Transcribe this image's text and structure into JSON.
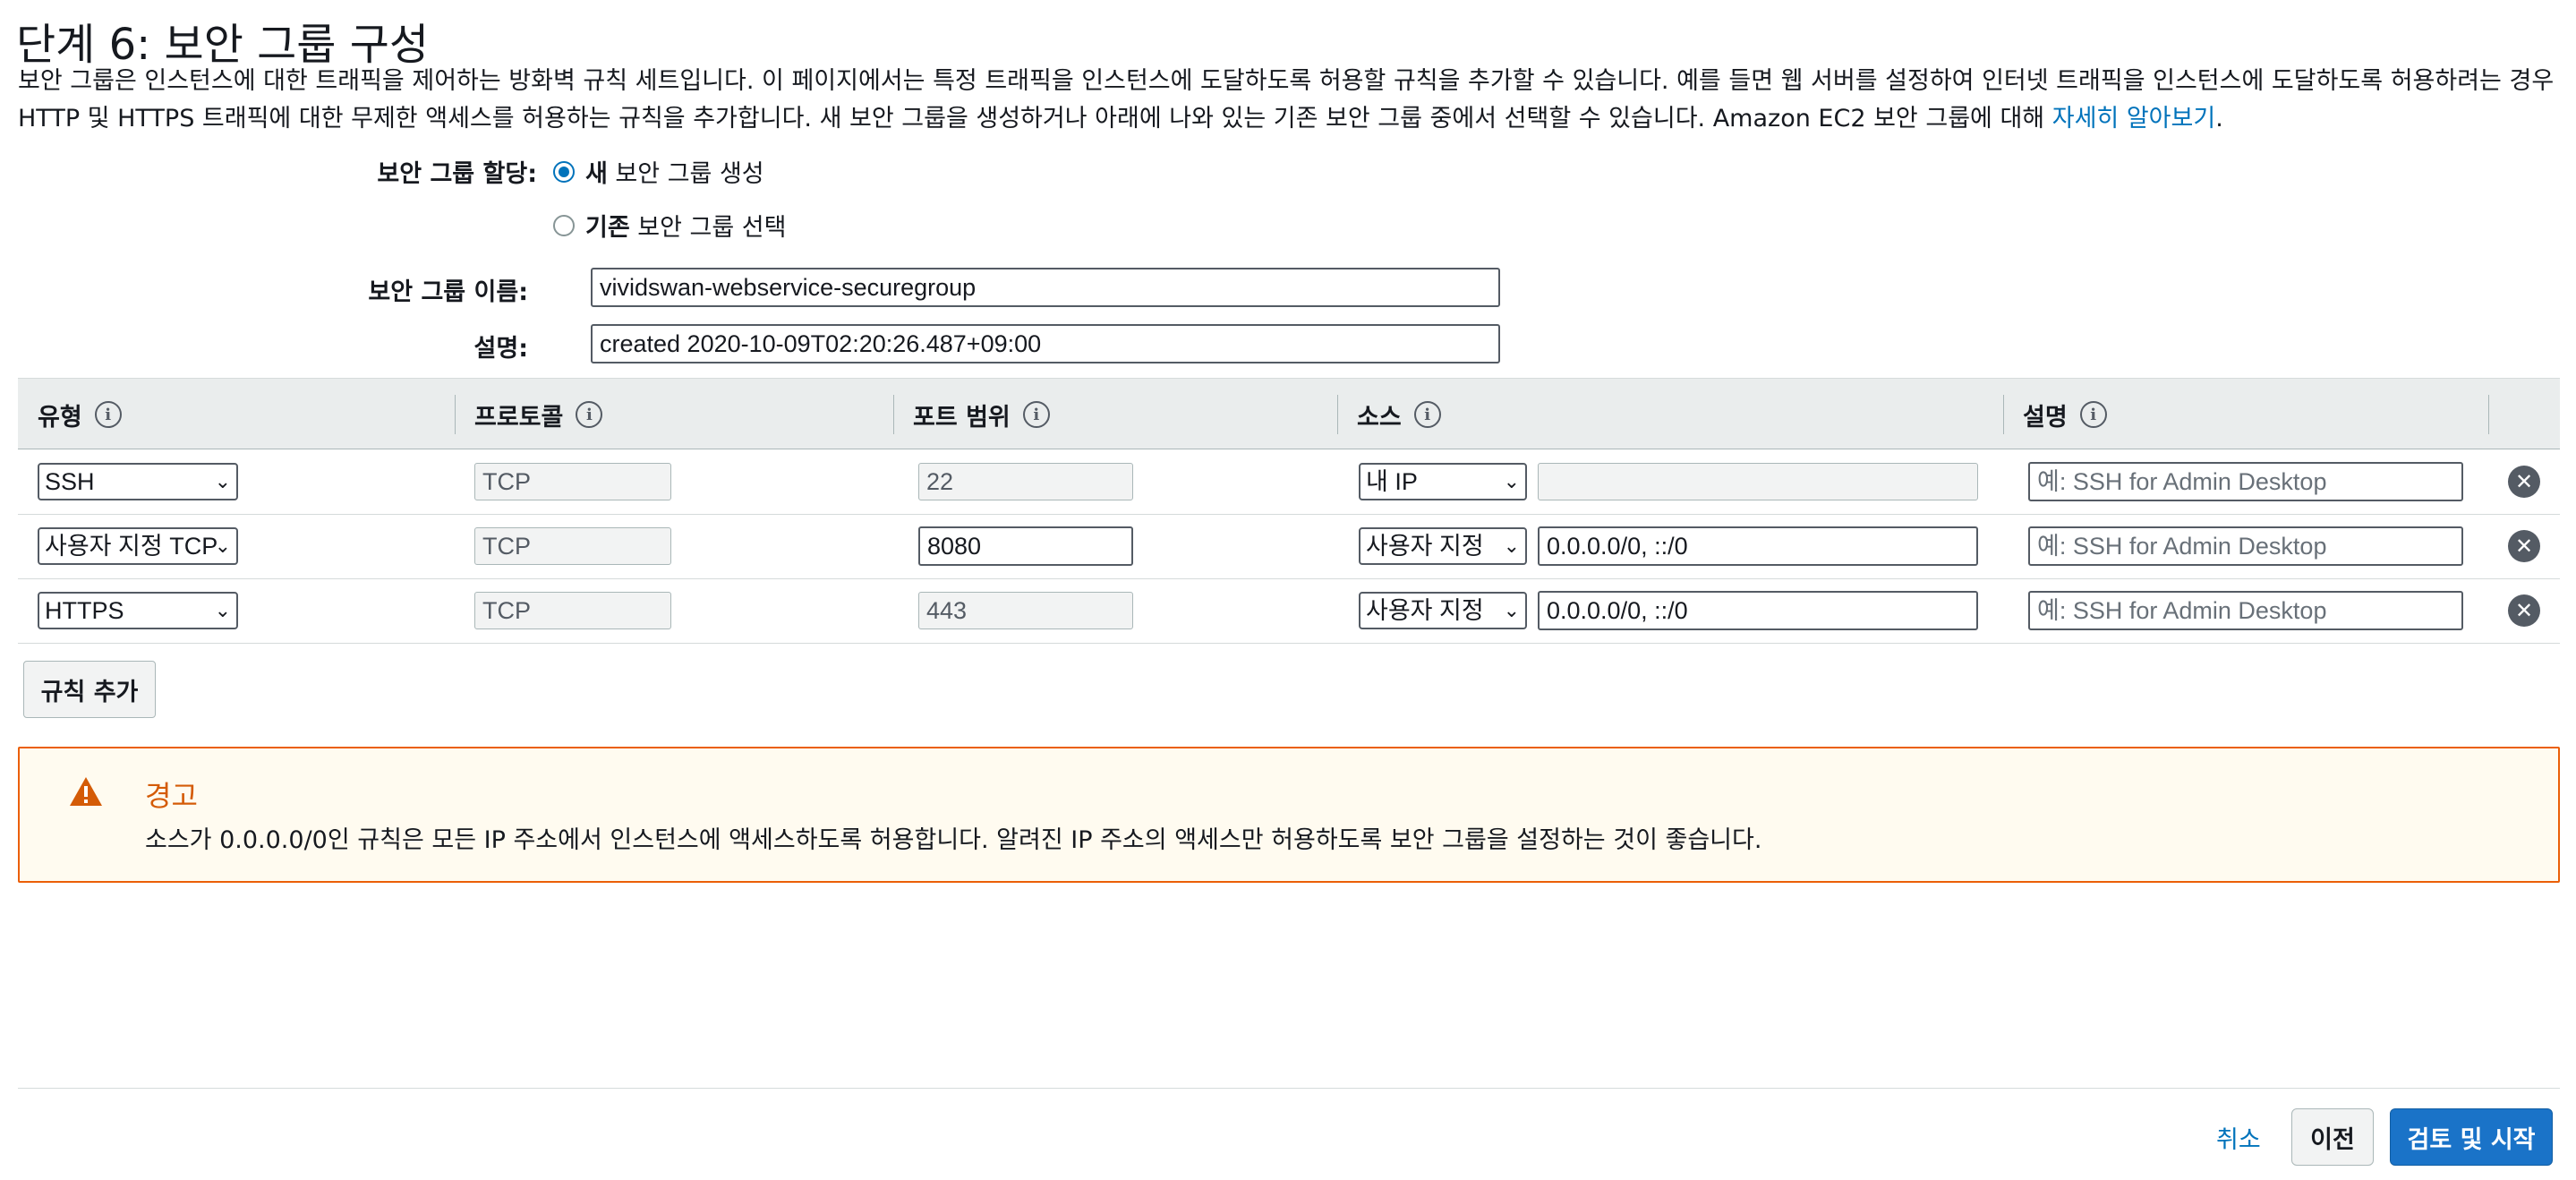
{
  "page": {
    "title": "단계 6: 보안 그룹 구성",
    "intro_text": "보안 그룹은 인스턴스에 대한 트래픽을 제어하는 방화벽 규칙 세트입니다. 이 페이지에서는 특정 트래픽을 인스턴스에 도달하도록 허용할 규칙을 추가할 수 있습니다. 예를 들면 웹 서버를 설정하여 인터넷 트래픽을 인스턴스에 도달하도록 허용하려는 경우 HTTP 및 HTTPS 트래픽에 대한 무제한 액세스를 허용하는 규칙을 추가합니다. 새 보안 그룹을 생성하거나 아래에 나와 있는 기존 보안 그룹 중에서 선택할 수 있습니다. Amazon EC2 보안 그룹에 대해",
    "learn_more_link": "자세히 알아보기",
    "intro_end": "."
  },
  "form": {
    "assign_label": "보안 그룹 할당:",
    "option_new_bold": "새",
    "option_new_rest": " 보안 그룹 생성",
    "option_existing_bold": "기존",
    "option_existing_rest": " 보안 그룹 선택",
    "selected_option": "new",
    "name_label": "보안 그룹 이름:",
    "name_value": "vividswan-webservice-securegroup",
    "desc_label": "설명:",
    "desc_value": "created 2020-10-09T02:20:26.487+09:00"
  },
  "table": {
    "headers": {
      "type": "유형",
      "protocol": "프로토콜",
      "port_range": "포트 범위",
      "source": "소스",
      "description": "설명"
    },
    "info_icon_glyph": "i",
    "rows": [
      {
        "type": "SSH",
        "protocol": "TCP",
        "port": "22",
        "port_editable": false,
        "source_type": "내 IP",
        "source_value": "",
        "source_editable": false,
        "description_placeholder": "예: SSH for Admin Desktop"
      },
      {
        "type": "사용자 지정 TCP",
        "protocol": "TCP",
        "port": "8080",
        "port_editable": true,
        "source_type": "사용자 지정",
        "source_value": "0.0.0.0/0, ::/0",
        "source_editable": true,
        "description_placeholder": "예: SSH for Admin Desktop"
      },
      {
        "type": "HTTPS",
        "protocol": "TCP",
        "port": "443",
        "port_editable": false,
        "source_type": "사용자 지정",
        "source_value": "0.0.0.0/0, ::/0",
        "source_editable": true,
        "description_placeholder": "예: SSH for Admin Desktop"
      }
    ],
    "remove_glyph": "✕",
    "caret_glyph": "⌄"
  },
  "add_rule_label": "규칙 추가",
  "warning": {
    "title": "경고",
    "text": "소스가 0.0.0.0/0인 규칙은 모든 IP 주소에서 인스턴스에 액세스하도록 허용합니다. 알려진 IP 주소의 액세스만 허용하도록 보안 그룹을 설정하는 것이 좋습니다.",
    "icon": "warning-triangle-icon"
  },
  "footer": {
    "cancel_label": "취소",
    "previous_label": "이전",
    "review_launch_label": "검토 및 시작"
  },
  "colors": {
    "link": "#0073bb",
    "primary_button": "#1a73c8",
    "warning_border": "#eb5f07",
    "warning_title": "#d45b07",
    "warning_bg": "#fffbf0",
    "table_header_bg": "#eaeded"
  }
}
